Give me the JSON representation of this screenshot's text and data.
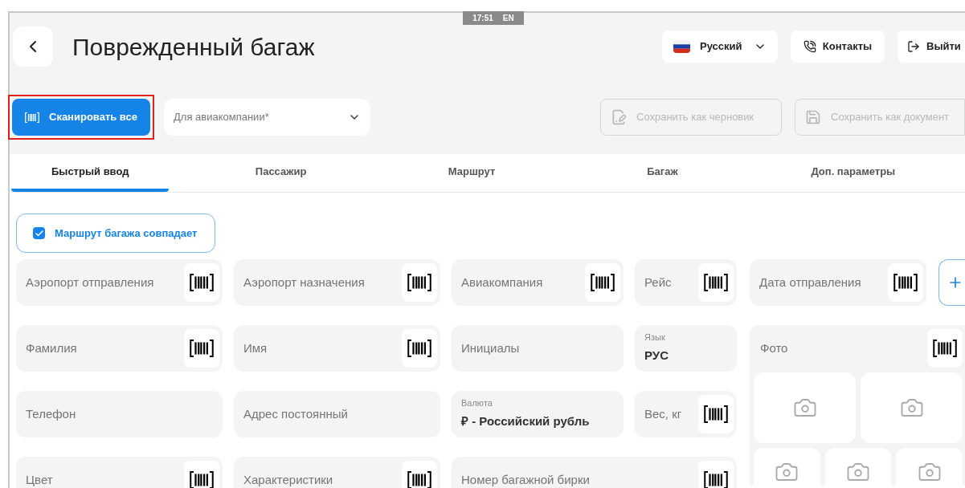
{
  "header": {
    "title": "Поврежденный багаж",
    "status": {
      "time": "17:51",
      "lang": "EN"
    },
    "language": "Русский",
    "contacts": "Контакты",
    "logout": "Выйти"
  },
  "toolbar": {
    "scan_all": "Сканировать все",
    "airline_select": {
      "placeholder": "Для авиакомпании*"
    },
    "save_draft": {
      "label": "Сохранить как черновик",
      "disabled": true
    },
    "save_document": {
      "label": "Сохранить как документ",
      "disabled": true
    }
  },
  "tabs": [
    {
      "label": "Быстрый ввод",
      "selected": true
    },
    {
      "label": "Пассажир",
      "selected": false
    },
    {
      "label": "Маршрут",
      "selected": false
    },
    {
      "label": "Багаж",
      "selected": false
    },
    {
      "label": "Доп. параметры",
      "selected": false
    }
  ],
  "route_match": {
    "label": "Маршрут багажа совпадает",
    "checked": true
  },
  "fields": [
    [
      {
        "kind": "scan",
        "label": "Аэропорт отправления"
      },
      {
        "kind": "scan",
        "label": "Аэропорт назначения"
      },
      {
        "kind": "scan",
        "label": "Авиакомпания"
      },
      {
        "kind": "scan",
        "label": "Рейс"
      }
    ],
    [
      {
        "kind": "scan",
        "label": "Фамилия"
      },
      {
        "kind": "scan",
        "label": "Имя"
      },
      {
        "kind": "plain",
        "label": "Инициалы"
      },
      {
        "kind": "value",
        "label": "Язык",
        "value": "РУС"
      }
    ],
    [
      {
        "kind": "plain",
        "label": "Телефон"
      },
      {
        "kind": "plain",
        "label": "Адрес постоянный"
      },
      {
        "kind": "value",
        "label": "Валюта",
        "value": "₽ - Российский рубль"
      },
      {
        "kind": "scan",
        "label": "Вес, кг"
      }
    ],
    [
      {
        "kind": "scan",
        "label": "Цвет"
      },
      {
        "kind": "scan",
        "label": "Характеристики"
      },
      {
        "kind": "scan",
        "label": "Номер багажной бирки"
      }
    ]
  ],
  "departure_date": {
    "label": "Дата отправления"
  },
  "photos": {
    "label": "Фото"
  }
}
